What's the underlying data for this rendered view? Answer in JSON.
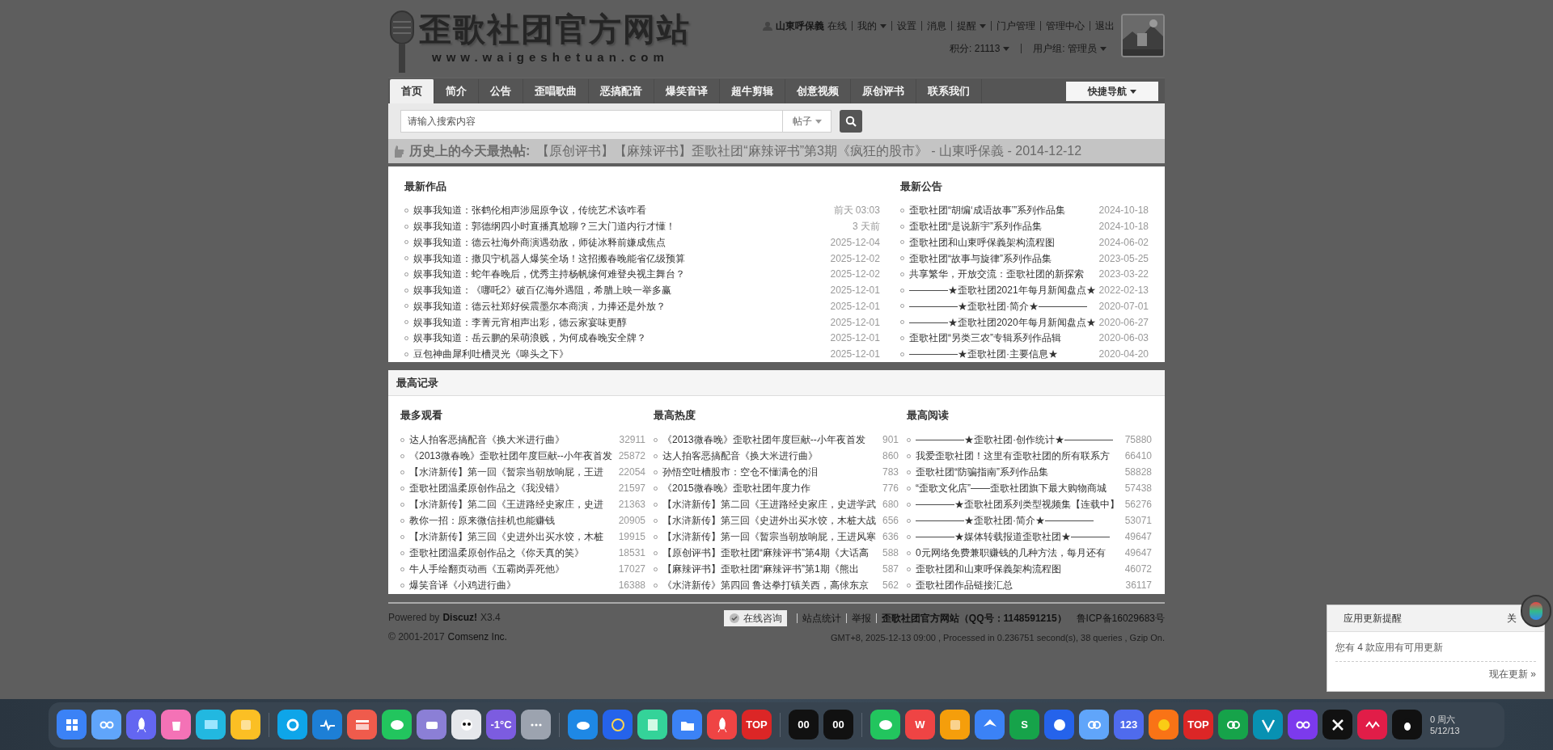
{
  "header": {
    "logo": {
      "title": "歪歌社团官方网站",
      "url": "www.waigeshetuan.com"
    },
    "user": {
      "name": "山東呼保義",
      "status": "在线",
      "links": [
        {
          "label": "我的",
          "dropdown": true
        },
        {
          "label": "设置",
          "dropdown": false
        },
        {
          "label": "消息",
          "dropdown": false
        },
        {
          "label": "提醒",
          "dropdown": true
        },
        {
          "label": "门户管理",
          "dropdown": false
        },
        {
          "label": "管理中心",
          "dropdown": false
        },
        {
          "label": "退出",
          "dropdown": false
        }
      ]
    },
    "credits": "积分: 21113",
    "group": "用户组: 管理员"
  },
  "nav": {
    "items": [
      {
        "label": "首页",
        "selected": true
      },
      {
        "label": "简介",
        "selected": false
      },
      {
        "label": "公告",
        "selected": false
      },
      {
        "label": "歪唱歌曲",
        "selected": false
      },
      {
        "label": "恶搞配音",
        "selected": false
      },
      {
        "label": "爆笑音译",
        "selected": false
      },
      {
        "label": "超牛剪辑",
        "selected": false
      },
      {
        "label": "创意视频",
        "selected": false
      },
      {
        "label": "原创评书",
        "selected": false
      },
      {
        "label": "联系我们",
        "selected": false
      }
    ],
    "quick_nav": "快捷导航"
  },
  "search": {
    "placeholder": "请输入搜索内容",
    "type": "帖子"
  },
  "hot": {
    "label": "历史上的今天最热帖:",
    "text": "【原创评书】【麻辣评书】歪歌社团“麻辣评书”第3期《疯狂的股市》 - 山東呼保義 - 2014-12-12"
  },
  "latest_works": {
    "title": "最新作品",
    "rows": [
      {
        "title": "娱事我知道：张鹤伦相声涉屈原争议，传统艺术该咋看",
        "time": "前天 03:03"
      },
      {
        "title": "娱事我知道：郭德纲四小时直播真尬聊？三大门道内行才懂！",
        "time": "3 天前"
      },
      {
        "title": "娱事我知道：德云社海外商演遇劲敌，师徒冰释前嫌成焦点",
        "time": "2025-12-04"
      },
      {
        "title": "娱事我知道：撒贝宁机器人爆笑全场！这招搬春晚能省亿级预算",
        "time": "2025-12-02"
      },
      {
        "title": "娱事我知道：蛇年春晚后，优秀主持杨帆缘何难登央视主舞台？",
        "time": "2025-12-02"
      },
      {
        "title": "娱事我知道：《哪吒2》破百亿海外遇阻，希腊上映一举多赢",
        "time": "2025-12-01"
      },
      {
        "title": "娱事我知道：德云社郑好侯震墨尔本商演，力捧还是外放？",
        "time": "2025-12-01"
      },
      {
        "title": "娱事我知道：李菁元宵相声出彩，德云家宴味更醇",
        "time": "2025-12-01"
      },
      {
        "title": "娱事我知道：岳云鹏的呆萌浪贱，为何成春晚安全牌？",
        "time": "2025-12-01"
      },
      {
        "title": "豆包神曲犀利吐槽灵光《嗥头之下》",
        "time": "2025-12-01"
      }
    ]
  },
  "latest_notices": {
    "title": "最新公告",
    "rows": [
      {
        "title": "歪歌社团“胡编‘成语故事’”系列作品集",
        "time": "2024-10-18"
      },
      {
        "title": "歪歌社团“是说新宇”系列作品集",
        "time": "2024-10-18"
      },
      {
        "title": "歪歌社团和山東呼保義架构流程图",
        "time": "2024-06-02"
      },
      {
        "title": "歪歌社团“故事与旋律”系列作品集",
        "time": "2023-05-25"
      },
      {
        "title": "共享繁华，开放交流：歪歌社团的新探索",
        "time": "2023-03-22"
      },
      {
        "title": "————★歪歌社团2021年每月新闻盘点★",
        "time": "2022-02-13"
      },
      {
        "title": "—————★歪歌社团·简介★—————",
        "time": "2020-07-01"
      },
      {
        "title": "————★歪歌社团2020年每月新闻盘点★",
        "time": "2020-06-27"
      },
      {
        "title": "歪歌社团“另类三农”专辑系列作品辑",
        "time": "2020-06-03"
      },
      {
        "title": "—————★歪歌社团·主要信息★",
        "time": "2020-04-20"
      }
    ]
  },
  "records": {
    "title": "最高记录",
    "columns": [
      {
        "title": "最多观看",
        "rows": [
          {
            "title": "达人拍客恶搞配音《换大米进行曲》",
            "count": "32911"
          },
          {
            "title": "《2013微春晚》歪歌社团年度巨献--小年夜首发",
            "count": "25872"
          },
          {
            "title": "【水浒新传】第一回《暂宗当朝放响屁，王进",
            "count": "22054"
          },
          {
            "title": "歪歌社团温柔原创作品之《我没错》",
            "count": "21597"
          },
          {
            "title": "【水浒新传】第二回《王进路经史家庄，史进",
            "count": "21363"
          },
          {
            "title": "教你一招：原来微信挂机也能赚钱",
            "count": "20905"
          },
          {
            "title": "【水浒新传】第三回《史进外出买水饺，木桩",
            "count": "19915"
          },
          {
            "title": "歪歌社团温柔原创作品之《你天真的笑》",
            "count": "18531"
          },
          {
            "title": "牛人手绘翻页动画《五霸岗弄死他》",
            "count": "17027"
          },
          {
            "title": "爆笑音译《小鸡进行曲》",
            "count": "16388"
          }
        ]
      },
      {
        "title": "最高热度",
        "rows": [
          {
            "title": "《2013微春晚》歪歌社团年度巨献--小年夜首发",
            "count": "901"
          },
          {
            "title": "达人拍客恶搞配音《换大米进行曲》",
            "count": "860"
          },
          {
            "title": "孙悟空吐槽股市：空仓不懂满仓的泪",
            "count": "783"
          },
          {
            "title": "《2015微春晚》歪歌社团年度力作",
            "count": "776"
          },
          {
            "title": "【水浒新传】第二回《王进路经史家庄，史进学武",
            "count": "680"
          },
          {
            "title": "【水浒新传】第三回《史进外出买水饺，木桩大战",
            "count": "656"
          },
          {
            "title": "【水浒新传】第一回《暂宗当朝放响屁，王进风寒",
            "count": "636"
          },
          {
            "title": "【原创评书】歪歌社团“麻辣评书”第4期《大话高",
            "count": "588"
          },
          {
            "title": "【麻辣评书】歪歌社团“麻辣评书”第1期《熊出",
            "count": "587"
          },
          {
            "title": "《水浒新传》第四回 鲁达拳打镇关西，高俅东京",
            "count": "562"
          }
        ]
      },
      {
        "title": "最高阅读",
        "rows": [
          {
            "title": "—————★歪歌社团·创作统计★—————",
            "count": "75880"
          },
          {
            "title": "我爱歪歌社团！这里有歪歌社团的所有联系方",
            "count": "66410"
          },
          {
            "title": "歪歌社团“防骗指南”系列作品集",
            "count": "58828"
          },
          {
            "title": "“歪歌文化店”——歪歌社团旗下最大购物商城",
            "count": "57438"
          },
          {
            "title": "————★歪歌社团系列类型视频集【连载中】",
            "count": "56276"
          },
          {
            "title": "—————★歪歌社团·简介★—————",
            "count": "53071"
          },
          {
            "title": "————★媒体转载报道歪歌社团★————",
            "count": "49647"
          },
          {
            "title": "0元网络免费兼职赚钱的几种方法，每月还有",
            "count": "49647"
          },
          {
            "title": "歪歌社团和山東呼保義架构流程图",
            "count": "46072"
          },
          {
            "title": "歪歌社团作品链接汇总",
            "count": "36117"
          }
        ]
      }
    ]
  },
  "footer": {
    "powered": "Powered by",
    "product": "Discuz!",
    "version": "X3.4",
    "copyright": "© 2001-2017",
    "company": "Comsenz Inc.",
    "consult": "在线咨询",
    "links": [
      "站点统计",
      "举报",
      "歪歌社团官方网站（QQ号：1148591215）"
    ],
    "icp": "鲁ICP备16029683号",
    "info": "GMT+8, 2025-12-13 09:00 , Processed in 0.236751 second(s), 38 queries , Gzip On."
  },
  "popup": {
    "title": "应用更新提醒",
    "close": "关",
    "message": "您有 4 款应用有可用更新",
    "action": "现在更新 »"
  },
  "taskbar": {
    "apps": [
      {
        "kind": "grid",
        "color": "#3b82f6"
      },
      {
        "kind": "face",
        "color": "#60a5fa"
      },
      {
        "kind": "rocket",
        "color": "#6366f1"
      },
      {
        "kind": "bin",
        "color": "#f472b6"
      },
      {
        "kind": "screen",
        "color": "#22b8e0"
      },
      {
        "kind": "square",
        "color": "#fbbf24"
      },
      {
        "kind": "sep"
      },
      {
        "kind": "gear",
        "color": "#0ea5e9"
      },
      {
        "kind": "pulse",
        "color": "#1d7fd6"
      },
      {
        "kind": "window",
        "color": "#ef5b4c"
      },
      {
        "kind": "chat",
        "color": "#22c55e"
      },
      {
        "kind": "printer",
        "color": "#8b7fd6"
      },
      {
        "kind": "panda",
        "color": "#e5e7eb"
      },
      {
        "kind": "text",
        "color": "#7c5ce0",
        "label": "-1°C"
      },
      {
        "kind": "dots",
        "color": "#9ca3af"
      },
      {
        "kind": "sep"
      },
      {
        "kind": "cloud",
        "color": "#1e88e5"
      },
      {
        "kind": "globe",
        "color": "#2563eb"
      },
      {
        "kind": "book",
        "color": "#34d399"
      },
      {
        "kind": "folder",
        "color": "#3b82f6"
      },
      {
        "kind": "rocket",
        "color": "#ef4444"
      },
      {
        "kind": "text",
        "color": "#dc2626",
        "label": "TOP"
      },
      {
        "kind": "sep"
      },
      {
        "kind": "text",
        "color": "#111111",
        "label": "00"
      },
      {
        "kind": "text",
        "color": "#111111",
        "label": "00"
      },
      {
        "kind": "sep"
      },
      {
        "kind": "chat",
        "color": "#22c55e"
      },
      {
        "kind": "text",
        "color": "#ef4444",
        "label": "W"
      },
      {
        "kind": "square",
        "color": "#f59e0b"
      },
      {
        "kind": "bird",
        "color": "#3b82f6"
      },
      {
        "kind": "text",
        "color": "#16a34a",
        "label": "S"
      },
      {
        "kind": "circle",
        "color": "#2563eb"
      },
      {
        "kind": "link",
        "color": "#60a5fa"
      },
      {
        "kind": "text",
        "color": "#4f6bed",
        "label": "123"
      },
      {
        "kind": "wheel",
        "color": "#f97316"
      },
      {
        "kind": "text",
        "color": "#dc2626",
        "label": "TOP"
      },
      {
        "kind": "link",
        "color": "#16a34a"
      },
      {
        "kind": "vee",
        "color": "#0891b2"
      },
      {
        "kind": "face",
        "color": "#7c3aed"
      },
      {
        "kind": "cut",
        "color": "#111111"
      },
      {
        "kind": "wave",
        "color": "#e11d48"
      },
      {
        "kind": "penguin",
        "color": "#111111"
      }
    ],
    "clock": {
      "time": "0 周六",
      "date": "5/12/13"
    }
  }
}
